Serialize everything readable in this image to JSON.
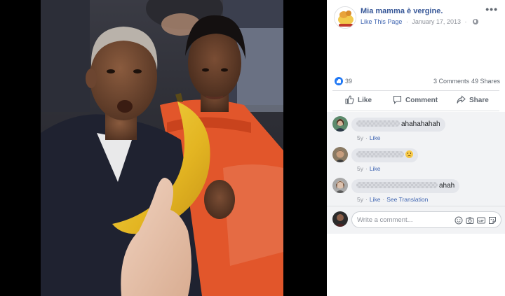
{
  "post": {
    "page_name": "Mia mamma è vergine.",
    "like_page_label": "Like This Page",
    "date": "January 17, 2013",
    "more_label": "•••",
    "privacy_icon": "globe-icon",
    "photo_subject": "photo"
  },
  "stats": {
    "likes": "39",
    "comments": "3 Comments",
    "shares": "49 Shares"
  },
  "actions": {
    "like": "Like",
    "comment": "Comment",
    "share": "Share"
  },
  "comments": [
    {
      "text": "ahahahahah",
      "age": "5y",
      "like": "Like",
      "translate": ""
    },
    {
      "text": "",
      "age": "5y",
      "like": "Like",
      "translate": ""
    },
    {
      "text": "ahah",
      "age": "5y",
      "like": "Like",
      "translate": "See Translation"
    }
  ],
  "composer": {
    "placeholder": "Write a comment..."
  },
  "colors": {
    "link": "#385898",
    "accent": "#4267b2",
    "like_blue": "#2078f4",
    "muted": "#90949c"
  }
}
